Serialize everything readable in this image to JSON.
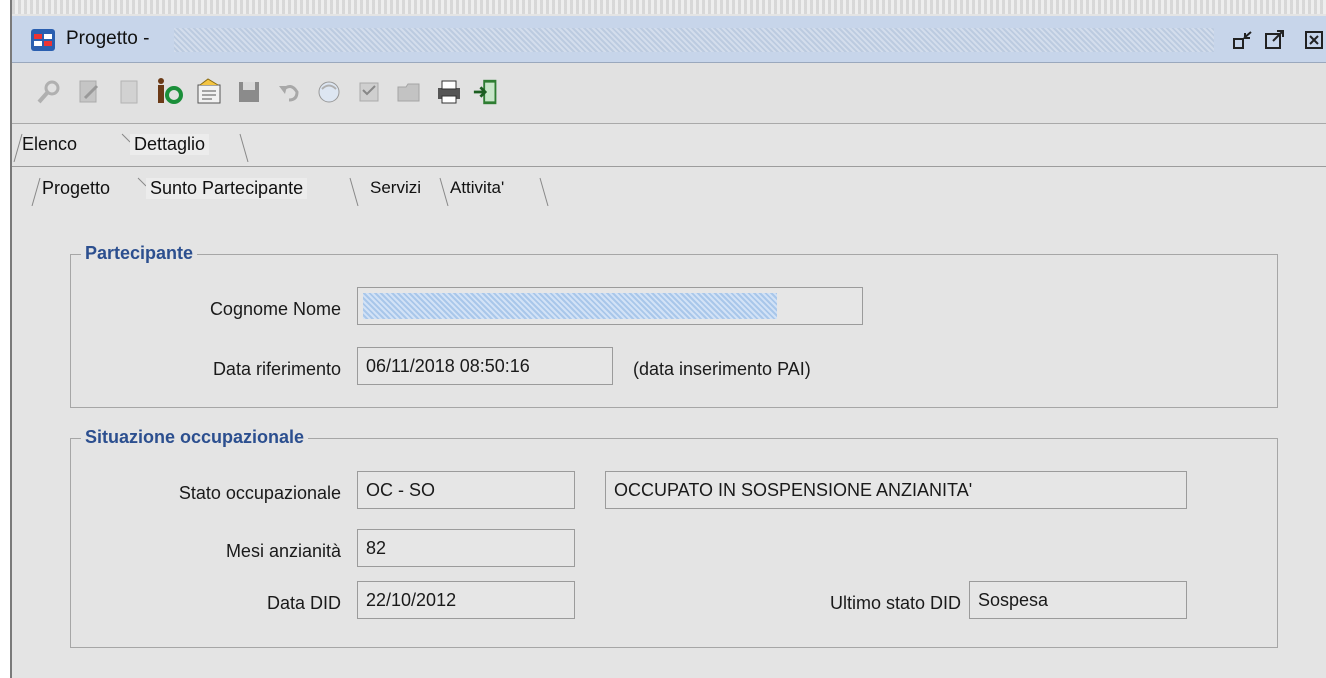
{
  "window": {
    "title": "Progetto -",
    "buttons": [
      "minimize-icon",
      "maximize-icon",
      "close-icon"
    ]
  },
  "toolbar": {
    "icons": [
      "search-icon",
      "edit-icon",
      "new-document-icon",
      "info-icon",
      "properties-icon",
      "save-icon",
      "undo-icon",
      "globe-icon",
      "checklist-icon",
      "folder-icon",
      "print-icon",
      "exit-icon"
    ]
  },
  "tabs_main": [
    "Elenco",
    "Dettaglio"
  ],
  "tabs_sub": [
    "Progetto",
    "Sunto Partecipante",
    "Servizi",
    "Attivita'"
  ],
  "partecipante": {
    "title": "Partecipante",
    "cognome_nome_label": "Cognome Nome",
    "cognome_nome_value": "",
    "data_riferimento_label": "Data riferimento",
    "data_riferimento_value": "06/11/2018 08:50:16",
    "data_riferimento_note": "(data inserimento PAI)"
  },
  "situazione": {
    "title": "Situazione occupazionale",
    "stato_label": "Stato occupazionale",
    "stato_code": "OC - SO",
    "stato_desc": "OCCUPATO IN SOSPENSIONE ANZIANITA'",
    "mesi_label": "Mesi anzianità",
    "mesi_value": "82",
    "data_did_label": "Data DID",
    "data_did_value": "22/10/2012",
    "ultimo_stato_label": "Ultimo stato DID",
    "ultimo_stato_value": "Sospesa"
  },
  "colors": {
    "title_bar": "#c7d5ea",
    "group_title": "#2c4f8f",
    "background": "#e4e4e4"
  }
}
